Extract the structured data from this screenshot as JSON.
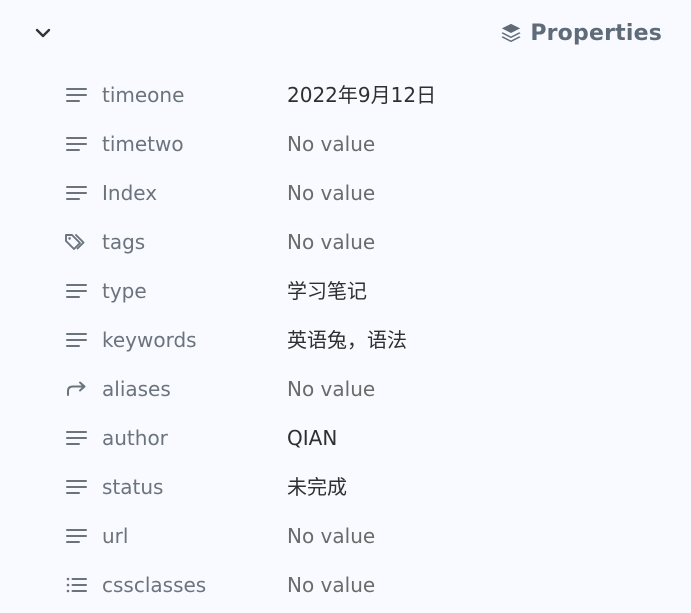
{
  "header": {
    "title": "Properties",
    "title_icon": "layers-icon",
    "collapse_icon": "chevron-down-icon"
  },
  "colors": {
    "background": "#f8faff",
    "title": "#5f6b78",
    "key_text": "#6b737d",
    "value_text": "#2f2f2f",
    "icon": "#6b737d"
  },
  "properties": [
    {
      "icon": "text-lines-icon",
      "key": "timeone",
      "value": "2022年9月12日",
      "empty": false
    },
    {
      "icon": "text-lines-icon",
      "key": "timetwo",
      "value": "No value",
      "empty": true
    },
    {
      "icon": "text-lines-icon",
      "key": "Index",
      "value": "No value",
      "empty": true
    },
    {
      "icon": "tags-icon",
      "key": "tags",
      "value": "No value",
      "empty": true
    },
    {
      "icon": "text-lines-icon",
      "key": "type",
      "value": "学习笔记",
      "empty": false
    },
    {
      "icon": "text-lines-icon",
      "key": "keywords",
      "value": "英语兔，语法",
      "empty": false
    },
    {
      "icon": "forward-arrow-icon",
      "key": "aliases",
      "value": "No value",
      "empty": true
    },
    {
      "icon": "text-lines-icon",
      "key": "author",
      "value": "QIAN",
      "empty": false
    },
    {
      "icon": "text-lines-icon",
      "key": "status",
      "value": "未完成",
      "empty": false
    },
    {
      "icon": "text-lines-icon",
      "key": "url",
      "value": "No value",
      "empty": true
    },
    {
      "icon": "list-icon",
      "key": "cssclasses",
      "value": "No value",
      "empty": true
    }
  ]
}
